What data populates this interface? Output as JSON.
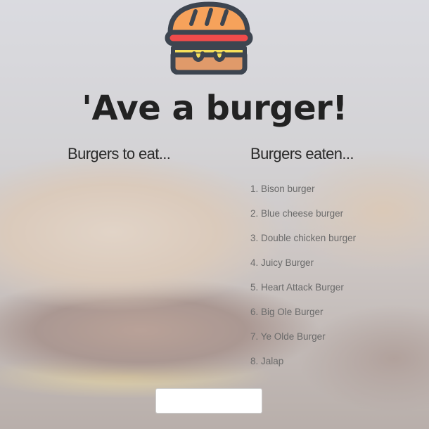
{
  "header": {
    "logo_icon": "burger-icon",
    "title": "'Ave a burger!"
  },
  "columns": {
    "to_eat": {
      "heading": "Burgers to eat...",
      "items": []
    },
    "eaten": {
      "heading": "Burgers eaten...",
      "items": [
        "1. Bison burger",
        "2. Blue cheese burger",
        "3. Double chicken burger",
        "4. Juicy Burger",
        "5. Heart Attack Burger",
        "6. Big Ole Burger",
        "7. Ye Olde Burger",
        "8. Jalap"
      ]
    }
  },
  "form": {
    "input_value": "",
    "input_placeholder": ""
  },
  "colors": {
    "title": "#222222",
    "list_text": "#6a6a6a",
    "logo_bun_top": "#f6a25b",
    "logo_tomato": "#ef4b4b",
    "logo_cheese": "#f6e05a",
    "logo_patty": "#e09a6a",
    "logo_outline": "#3d4550"
  }
}
